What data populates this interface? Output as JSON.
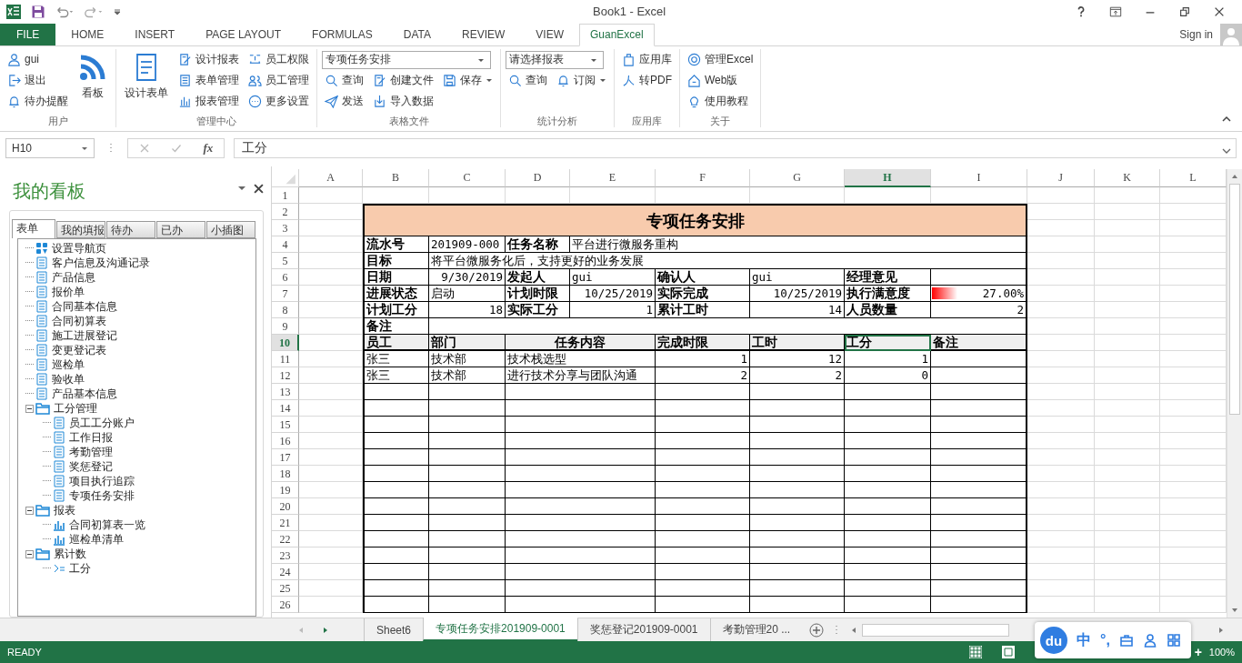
{
  "app": {
    "title": "Book1 - Excel",
    "sign_in": "Sign in"
  },
  "ribbon_tabs": [
    {
      "label": "FILE",
      "kind": "file",
      "selected": false
    },
    {
      "label": "HOME",
      "kind": "tab",
      "selected": false
    },
    {
      "label": "INSERT",
      "kind": "tab",
      "selected": false
    },
    {
      "label": "PAGE LAYOUT",
      "kind": "tab",
      "selected": false
    },
    {
      "label": "FORMULAS",
      "kind": "tab",
      "selected": false
    },
    {
      "label": "DATA",
      "kind": "tab",
      "selected": false
    },
    {
      "label": "REVIEW",
      "kind": "tab",
      "selected": false
    },
    {
      "label": "VIEW",
      "kind": "tab",
      "selected": false
    },
    {
      "label": "GuanExcel",
      "kind": "tab",
      "selected": true
    }
  ],
  "ribbon": {
    "groups": [
      {
        "label": "用户",
        "columns": [
          {
            "items": [
              {
                "kind": "small",
                "label": "gui"
              },
              {
                "kind": "small",
                "label": "退出"
              },
              {
                "kind": "small",
                "label": "待办提醒"
              }
            ]
          },
          {
            "items": [
              {
                "kind": "big",
                "label": "看板"
              }
            ]
          }
        ]
      },
      {
        "label": "管理中心",
        "columns": [
          {
            "items": [
              {
                "kind": "big",
                "label": "设计表单"
              }
            ]
          },
          {
            "items": [
              {
                "kind": "small",
                "label": "设计报表"
              },
              {
                "kind": "small",
                "label": "表单管理"
              },
              {
                "kind": "small",
                "label": "报表管理"
              }
            ]
          },
          {
            "items": [
              {
                "kind": "small",
                "label": "员工权限"
              },
              {
                "kind": "small",
                "label": "员工管理"
              },
              {
                "kind": "small",
                "label": "更多设置"
              }
            ]
          }
        ]
      },
      {
        "label": "表格文件",
        "select": {
          "value": "专项任务安排"
        },
        "columns": [
          {
            "items": [
              {
                "kind": "small",
                "label": "查询"
              },
              {
                "kind": "small",
                "label": "发送"
              }
            ]
          },
          {
            "items": [
              {
                "kind": "small",
                "label": "创建文件"
              },
              {
                "kind": "small",
                "label": "导入数据"
              }
            ]
          },
          {
            "items": [
              {
                "kind": "split",
                "label": "保存"
              }
            ]
          }
        ]
      },
      {
        "label": "统计分析",
        "select": {
          "value": "请选择报表"
        },
        "columns": [
          {
            "items": [
              {
                "kind": "small",
                "label": "查询"
              }
            ]
          },
          {
            "items": [
              {
                "kind": "split",
                "label": "订阅"
              }
            ]
          }
        ]
      },
      {
        "label": "应用库",
        "columns": [
          {
            "items": [
              {
                "kind": "small",
                "label": "应用库"
              },
              {
                "kind": "small",
                "label": "转PDF"
              }
            ]
          }
        ]
      },
      {
        "label": "关于",
        "columns": [
          {
            "items": [
              {
                "kind": "small",
                "label": "管理Excel"
              },
              {
                "kind": "small",
                "label": "Web版"
              },
              {
                "kind": "small",
                "label": "使用教程"
              }
            ]
          }
        ]
      }
    ]
  },
  "formula_bar": {
    "name_box": "H10",
    "function_label": "fx",
    "content": "工分"
  },
  "board": {
    "title": "我的看板",
    "tabs": [
      {
        "label": "表单",
        "selected": true
      },
      {
        "label": "我的填报",
        "selected": false
      },
      {
        "label": "待办",
        "selected": false
      },
      {
        "label": "已办",
        "selected": false
      },
      {
        "label": "小插图",
        "selected": false
      }
    ],
    "tree": [
      {
        "kind": "nav",
        "label": "设置导航页"
      },
      {
        "kind": "form",
        "label": "客户信息及沟通记录"
      },
      {
        "kind": "form",
        "label": "产品信息"
      },
      {
        "kind": "form",
        "label": "报价单"
      },
      {
        "kind": "form",
        "label": "合同基本信息"
      },
      {
        "kind": "form",
        "label": "合同初算表"
      },
      {
        "kind": "form",
        "label": "施工进展登记"
      },
      {
        "kind": "form",
        "label": "变更登记表"
      },
      {
        "kind": "form",
        "label": "巡检单"
      },
      {
        "kind": "form",
        "label": "验收单"
      },
      {
        "kind": "form",
        "label": "产品基本信息"
      },
      {
        "kind": "folder",
        "label": "工分管理",
        "expanded": true,
        "children": [
          {
            "kind": "form",
            "label": "员工工分账户"
          },
          {
            "kind": "form",
            "label": "工作日报"
          },
          {
            "kind": "form",
            "label": "考勤管理"
          },
          {
            "kind": "form",
            "label": "奖惩登记"
          },
          {
            "kind": "form",
            "label": "项目执行追踪"
          },
          {
            "kind": "form",
            "label": "专项任务安排"
          }
        ]
      },
      {
        "kind": "folder",
        "label": "报表",
        "expanded": true,
        "children": [
          {
            "kind": "report",
            "label": "合同初算表一览"
          },
          {
            "kind": "report",
            "label": "巡检单清单"
          }
        ]
      },
      {
        "kind": "folder",
        "label": "累计数",
        "expanded": true,
        "children": [
          {
            "kind": "sum",
            "label": "工分"
          }
        ]
      }
    ]
  },
  "sheet": {
    "columns": [
      {
        "label": "A",
        "selected": false
      },
      {
        "label": "B",
        "selected": false
      },
      {
        "label": "C",
        "selected": false
      },
      {
        "label": "D",
        "selected": false
      },
      {
        "label": "E",
        "selected": false
      },
      {
        "label": "F",
        "selected": false
      },
      {
        "label": "G",
        "selected": false
      },
      {
        "label": "H",
        "selected": true
      },
      {
        "label": "I",
        "selected": false
      },
      {
        "label": "J",
        "selected": false
      },
      {
        "label": "K",
        "selected": false
      },
      {
        "label": "L",
        "selected": false
      }
    ],
    "rows": [
      {
        "numbers": [
          "1"
        ],
        "kind": "blank",
        "selected": false
      },
      {
        "numbers": [
          "2",
          "3"
        ],
        "kind": "banner",
        "selected": false,
        "cells": [
          {
            "kind": "title",
            "text": "专项任务安排"
          }
        ]
      },
      {
        "numbers": [
          "4"
        ],
        "kind": "info4",
        "selected": false,
        "cells": [
          {
            "kind": "label",
            "text": "流水号"
          },
          {
            "kind": "text",
            "text": "201909-000"
          },
          {
            "kind": "label",
            "text": "任务名称"
          },
          {
            "kind": "text",
            "text": "平台进行微服务重构"
          }
        ]
      },
      {
        "numbers": [
          "5"
        ],
        "kind": "info2",
        "selected": false,
        "cells": [
          {
            "kind": "label",
            "text": "目标"
          },
          {
            "kind": "text",
            "text": "将平台微服务化后，支持更好的业务发展"
          }
        ]
      },
      {
        "numbers": [
          "6"
        ],
        "kind": "grid8",
        "selected": false,
        "cells": [
          {
            "kind": "label",
            "text": "日期"
          },
          {
            "kind": "number",
            "text": "9/30/2019"
          },
          {
            "kind": "label",
            "text": "发起人"
          },
          {
            "kind": "text",
            "text": "gui"
          },
          {
            "kind": "label",
            "text": "确认人"
          },
          {
            "kind": "text",
            "text": "gui"
          },
          {
            "kind": "label",
            "text": "经理意见"
          }
        ]
      },
      {
        "numbers": [
          "7"
        ],
        "kind": "grid8",
        "selected": false,
        "cells": [
          {
            "kind": "label",
            "text": "进展状态"
          },
          {
            "kind": "text",
            "text": "启动"
          },
          {
            "kind": "label",
            "text": "计划时限"
          },
          {
            "kind": "number",
            "text": "10/25/2019"
          },
          {
            "kind": "label",
            "text": "实际完成"
          },
          {
            "kind": "number",
            "text": "10/25/2019"
          },
          {
            "kind": "label",
            "text": "执行满意度"
          },
          {
            "kind": "progress",
            "level": 0.27,
            "text": "27.00%"
          }
        ]
      },
      {
        "numbers": [
          "8"
        ],
        "kind": "grid8",
        "selected": false,
        "cells": [
          {
            "kind": "label",
            "text": "计划工分"
          },
          {
            "kind": "number",
            "text": "18"
          },
          {
            "kind": "label",
            "text": "实际工分"
          },
          {
            "kind": "number",
            "text": "1"
          },
          {
            "kind": "label",
            "text": "累计工时"
          },
          {
            "kind": "number",
            "text": "14"
          },
          {
            "kind": "label",
            "text": "人员数量"
          },
          {
            "kind": "number",
            "text": "2"
          }
        ]
      },
      {
        "numbers": [
          "9"
        ],
        "kind": "info2",
        "selected": false,
        "cells": [
          {
            "kind": "label",
            "text": "备注"
          }
        ]
      },
      {
        "numbers": [
          "10"
        ],
        "kind": "table",
        "selected": true,
        "cells": [
          {
            "kind": "header",
            "text": "员工"
          },
          {
            "kind": "header",
            "text": "部门"
          },
          {
            "kind": "centered",
            "text": "任务内容"
          },
          {
            "kind": "header",
            "text": "完成时限"
          },
          {
            "kind": "header",
            "text": "工时"
          },
          {
            "kind": "header",
            "text": "工分"
          },
          {
            "kind": "header",
            "text": "备注"
          }
        ]
      },
      {
        "numbers": [
          "11"
        ],
        "kind": "table",
        "selected": false,
        "cells": [
          {
            "kind": "text",
            "text": "张三"
          },
          {
            "kind": "text",
            "text": "技术部"
          },
          {
            "kind": "text",
            "text": "技术栈选型"
          },
          {
            "kind": "number",
            "text": "1"
          },
          {
            "kind": "number",
            "text": "12"
          },
          {
            "kind": "number",
            "text": "1"
          }
        ]
      },
      {
        "numbers": [
          "12"
        ],
        "kind": "table",
        "selected": false,
        "cells": [
          {
            "kind": "text",
            "text": "张三"
          },
          {
            "kind": "text",
            "text": "技术部"
          },
          {
            "kind": "text",
            "text": "进行技术分享与团队沟通"
          },
          {
            "kind": "number",
            "text": "2"
          },
          {
            "kind": "number",
            "text": "2"
          },
          {
            "kind": "number",
            "text": "0"
          }
        ]
      },
      {
        "numbers": [
          "13"
        ],
        "kind": "table",
        "selected": false
      },
      {
        "numbers": [
          "14"
        ],
        "kind": "table",
        "selected": false
      },
      {
        "numbers": [
          "15"
        ],
        "kind": "table",
        "selected": false
      },
      {
        "numbers": [
          "16"
        ],
        "kind": "table",
        "selected": false
      },
      {
        "numbers": [
          "17"
        ],
        "kind": "table",
        "selected": false
      },
      {
        "numbers": [
          "18"
        ],
        "kind": "table",
        "selected": false
      },
      {
        "numbers": [
          "19"
        ],
        "kind": "table",
        "selected": false
      },
      {
        "numbers": [
          "20"
        ],
        "kind": "table",
        "selected": false
      },
      {
        "numbers": [
          "21"
        ],
        "kind": "table",
        "selected": false
      },
      {
        "numbers": [
          "22"
        ],
        "kind": "table",
        "selected": false
      },
      {
        "numbers": [
          "23"
        ],
        "kind": "table",
        "selected": false
      },
      {
        "numbers": [
          "24"
        ],
        "kind": "table",
        "selected": false
      },
      {
        "numbers": [
          "25"
        ],
        "kind": "table",
        "selected": false
      },
      {
        "numbers": [
          "26"
        ],
        "kind": "table",
        "selected": false
      }
    ]
  },
  "sheet_tabs": [
    {
      "label": "Sheet6",
      "selected": false
    },
    {
      "label": "专项任务安排201909-0001",
      "selected": true
    },
    {
      "label": "奖惩登记201909-0001",
      "selected": false
    },
    {
      "label": "考勤管理20 ...",
      "selected": false
    }
  ],
  "ime_bar": {
    "logo": "du",
    "items": [
      "中",
      "°,"
    ]
  },
  "status": {
    "mode": "READY",
    "zoom_in": "+",
    "zoom": "100%"
  }
}
